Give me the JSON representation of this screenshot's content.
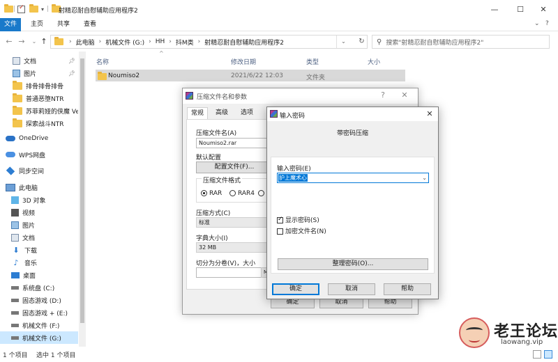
{
  "window": {
    "title": "射精忍耐自慰辅助应用程序2",
    "controls": {
      "minimize": "—",
      "maximize": "☐",
      "close": "✕"
    }
  },
  "ribbon": {
    "tabs": [
      "文件",
      "主页",
      "共享",
      "查看"
    ],
    "collapse": "⌄",
    "help": "?"
  },
  "address": {
    "path": [
      "此电脑",
      "机械文件 (G:)",
      "HH",
      "抖M类",
      "射精忍耐自慰辅助应用程序2"
    ],
    "search_placeholder": "搜索\"射精忍耐自慰辅助应用程序2\""
  },
  "sidebar": {
    "items": [
      {
        "label": "文档",
        "icon": "document-icon",
        "pinned": true
      },
      {
        "label": "图片",
        "icon": "picture-icon",
        "pinned": true
      },
      {
        "label": "排骨排骨排骨",
        "icon": "folder-icon"
      },
      {
        "label": "普通恶堕NTR",
        "icon": "folder-icon"
      },
      {
        "label": "苏菲莉娅的侠魔 Ver",
        "icon": "folder-icon"
      },
      {
        "label": "探索战斗NTR",
        "icon": "folder-icon"
      },
      {
        "label": "OneDrive",
        "icon": "cloud-icon"
      },
      {
        "label": "WPS网盘",
        "icon": "wps-cloud-icon"
      },
      {
        "label": "同步空间",
        "icon": "sync-icon"
      },
      {
        "label": "此电脑",
        "icon": "computer-icon"
      },
      {
        "label": "3D 对象",
        "icon": "cube-icon"
      },
      {
        "label": "视频",
        "icon": "video-icon"
      },
      {
        "label": "图片",
        "icon": "picture-icon"
      },
      {
        "label": "文档",
        "icon": "document-icon"
      },
      {
        "label": "下载",
        "icon": "download-icon"
      },
      {
        "label": "音乐",
        "icon": "music-icon"
      },
      {
        "label": "桌面",
        "icon": "desktop-icon"
      },
      {
        "label": "系统盘 (C:)",
        "icon": "drive-icon"
      },
      {
        "label": "固态游戏 (D:)",
        "icon": "drive-icon"
      },
      {
        "label": "固态游戏 + (E:)",
        "icon": "drive-icon"
      },
      {
        "label": "机械文件 (F:)",
        "icon": "drive-icon"
      },
      {
        "label": "机械文件 (G:)",
        "icon": "drive-icon",
        "selected": true
      }
    ]
  },
  "columns": {
    "name": "名称",
    "date": "修改日期",
    "type": "类型",
    "size": "大小"
  },
  "files": [
    {
      "name": "Noumiso2",
      "date": "2021/6/22 12:03",
      "type": "文件夹",
      "size": ""
    }
  ],
  "status": {
    "count": "1 个项目",
    "selected": "选中 1 个项目"
  },
  "archive_dialog": {
    "title": "压缩文件名和参数",
    "help": "?",
    "close": "✕",
    "tabs": [
      "常规",
      "高级",
      "选项"
    ],
    "archive_name_label": "压缩文件名(A)",
    "archive_name": "Noumiso2.rar",
    "default_profile_label": "默认配置",
    "profile_button": "配置文件(F)...",
    "format_label": "压缩文件格式",
    "formats": [
      "RAR",
      "RAR4",
      "Z"
    ],
    "method_label": "压缩方式(C)",
    "method": "标准",
    "dict_label": "字典大小(I)",
    "dict": "32 MB",
    "split_label": "切分为分卷(V)，大小",
    "split_unit": "M",
    "ok": "确定",
    "cancel": "取消",
    "help_button": "帮助"
  },
  "password_dialog": {
    "title": "输入密码",
    "close": "✕",
    "heading": "带密码压缩",
    "enter_label": "输入密码(E)",
    "password_value": "护上魔术心",
    "show_password": "显示密码(S)",
    "show_password_checked": true,
    "encrypt_names": "加密文件名(N)",
    "encrypt_names_checked": false,
    "organize_button": "整理密码(O)...",
    "ok": "确定",
    "cancel": "取消",
    "help": "帮助"
  },
  "watermark": {
    "text": "老王论坛",
    "url": "laowang.vip"
  }
}
